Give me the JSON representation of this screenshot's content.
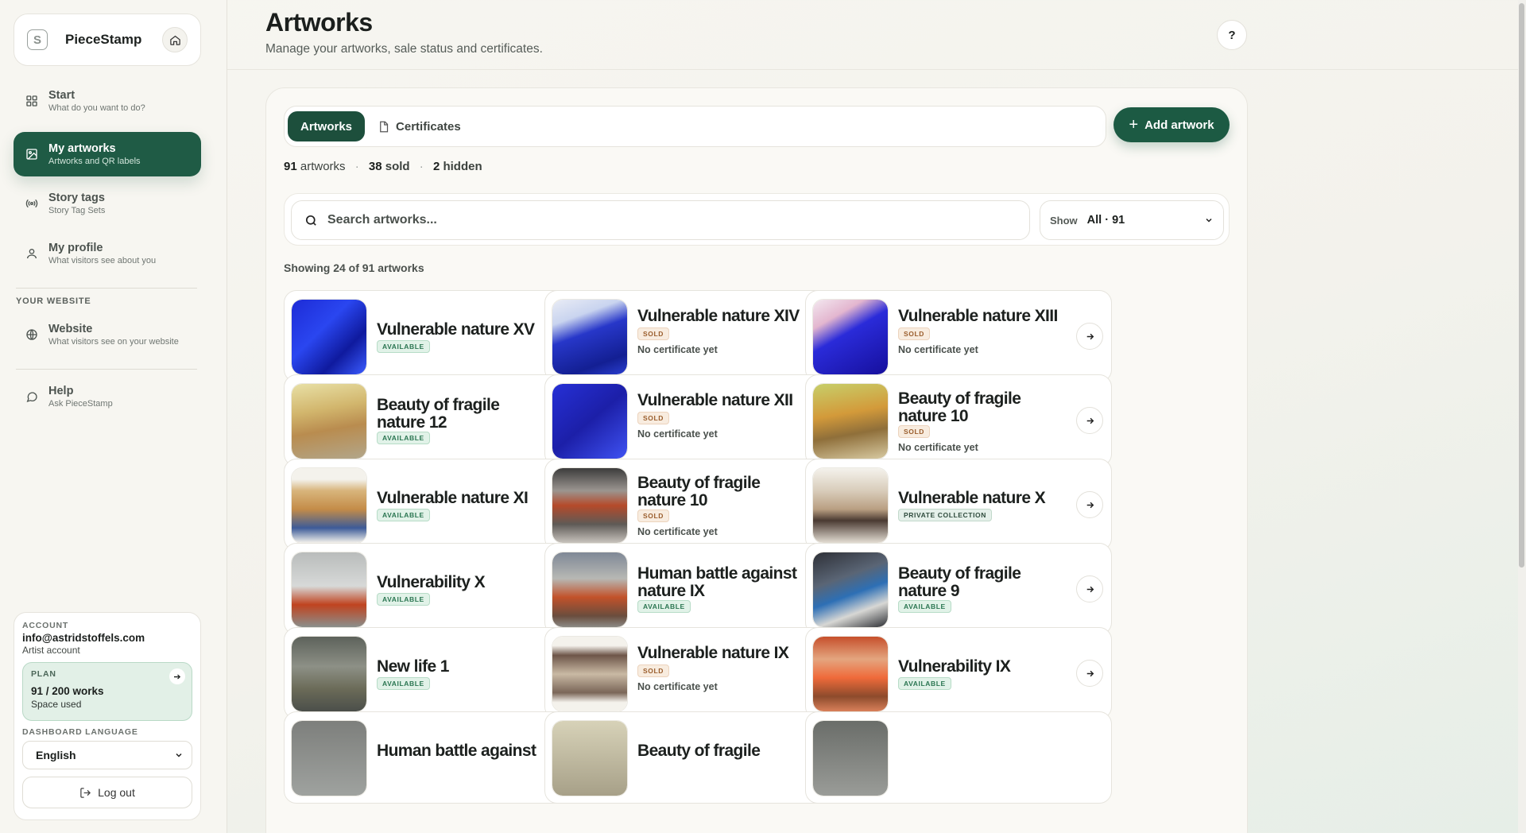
{
  "brand": {
    "name": "PieceStamp",
    "logo_letter": "S"
  },
  "nav": [
    {
      "title": "Start",
      "sub": "What do you want to do?",
      "icon": "grid-icon"
    },
    {
      "title": "My artworks",
      "sub": "Artworks and QR labels",
      "icon": "image-icon",
      "active": true
    },
    {
      "title": "Story tags",
      "sub": "Story Tag Sets",
      "icon": "broadcast-icon"
    },
    {
      "title": "My profile",
      "sub": "What visitors see about you",
      "icon": "user-icon"
    }
  ],
  "website_section": {
    "label": "YOUR WEBSITE",
    "website": {
      "title": "Website",
      "sub": "What visitors see on your website",
      "icon": "globe-icon"
    },
    "help": {
      "title": "Help",
      "sub": "Ask PieceStamp",
      "icon": "chat-icon"
    }
  },
  "account": {
    "label": "ACCOUNT",
    "email": "info@astridstoffels.com",
    "type": "Artist account",
    "plan_label": "PLAN",
    "plan_count": "91 / 200 works",
    "plan_sub": "Space used",
    "plan_used_fraction": 0.455,
    "language_label": "DASHBOARD LANGUAGE",
    "language": "English",
    "logout": "Log out"
  },
  "header": {
    "title": "Artworks",
    "subtitle": "Manage your artworks, sale status and certificates.",
    "help": "?"
  },
  "tabs": [
    {
      "label": "Artworks",
      "active": true
    },
    {
      "label": "Certificates",
      "active": false
    }
  ],
  "add_button": "Add artwork",
  "stats": {
    "artworks": "91",
    "artworks_label": "artworks",
    "sold": "38",
    "sold_label": "sold",
    "hidden": "2",
    "hidden_label": "hidden",
    "sep": "·"
  },
  "search": {
    "placeholder": "Search artworks...",
    "show_label": "Show",
    "show_value": "All · 91"
  },
  "showing": "Showing 24 of 91 artworks",
  "artworks": [
    {
      "title": "Vulnerable nature XV",
      "status": "AVAILABLE",
      "cert": ""
    },
    {
      "title": "Vulnerable nature XIV",
      "status": "SOLD",
      "cert": "No certificate yet"
    },
    {
      "title": "Vulnerable nature XIII",
      "status": "SOLD",
      "cert": "No certificate yet"
    },
    {
      "title": "Beauty of fragile nature 12",
      "status": "AVAILABLE",
      "cert": ""
    },
    {
      "title": "Vulnerable nature XII",
      "status": "SOLD",
      "cert": "No certificate yet"
    },
    {
      "title": "Beauty of fragile nature 10",
      "status": "SOLD",
      "cert": "No certificate yet"
    },
    {
      "title": "Vulnerable nature XI",
      "status": "AVAILABLE",
      "cert": ""
    },
    {
      "title": "Beauty of fragile nature 10",
      "status": "SOLD",
      "cert": "No certificate yet"
    },
    {
      "title": "Vulnerable nature X",
      "status": "PRIVATE COLLECTION",
      "cert": ""
    },
    {
      "title": "Vulnerability X",
      "status": "AVAILABLE",
      "cert": ""
    },
    {
      "title": "Human battle against nature IX",
      "status": "AVAILABLE",
      "cert": ""
    },
    {
      "title": "Beauty of fragile nature 9",
      "status": "AVAILABLE",
      "cert": ""
    },
    {
      "title": "New life 1",
      "status": "AVAILABLE",
      "cert": ""
    },
    {
      "title": "Vulnerable nature IX",
      "status": "SOLD",
      "cert": "No certificate yet"
    },
    {
      "title": "Vulnerability IX",
      "status": "AVAILABLE",
      "cert": ""
    },
    {
      "title": "Human battle against",
      "status": "",
      "cert": ""
    },
    {
      "title": "Beauty of fragile",
      "status": "",
      "cert": ""
    },
    {
      "title": "",
      "status": "",
      "cert": ""
    }
  ],
  "colors": {
    "accent": "#1f5b45",
    "available": "#2a7551",
    "sold": "#9a5d2c"
  }
}
